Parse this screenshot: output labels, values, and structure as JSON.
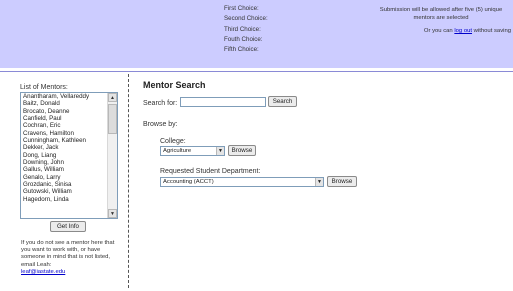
{
  "choices": [
    "First Choice:",
    "Second Choice:",
    "Third Choice:",
    "Fouth Choice:",
    "Fifth Choice:"
  ],
  "notice": {
    "submission_text": "Submission will be allowed after five (5) unique mentors are selected",
    "logout_prefix": "Or you can ",
    "logout_link": "log out",
    "logout_suffix": " without saving"
  },
  "mentor_panel": {
    "label": "List of Mentors:",
    "mentors": [
      "Anantharam, Vellareddy",
      "Baitz, Donald",
      "Brocato, Deanne",
      "Canfield, Paul",
      "Cochran, Eric",
      "Cravens, Hamilton",
      "Cunningham, Kathleen",
      "Dekker, Jack",
      "Dong, Liang",
      "Downing, John",
      "Gallus, William",
      "Genalo, Larry",
      "Grozdanic, Sinisa",
      "Gutowski, William",
      "Hagedorn, Linda"
    ],
    "get_info_label": "Get Info",
    "help_text": "If you do not see a mentor here that you want to work with, or have someone in mind that is not listed, email Leah:",
    "email": "leaf@iastate.edu"
  },
  "search": {
    "title": "Mentor Search",
    "search_label": "Search for:",
    "search_value": "",
    "search_button": "Search",
    "browse_label": "Browse by:",
    "college_label": "College:",
    "college_selected": "Agriculture",
    "college_browse_button": "Browse",
    "dept_label": "Requested Student Department:",
    "dept_selected": "Accounting (ACCT)",
    "dept_browse_button": "Browse"
  },
  "icons": {
    "select_arrow": "chevron-down-icon",
    "scroll_up": "scroll-up-icon",
    "scroll_down": "scroll-down-icon"
  },
  "colors": {
    "top_bar": "#ccccff",
    "link": "#0000cc"
  }
}
